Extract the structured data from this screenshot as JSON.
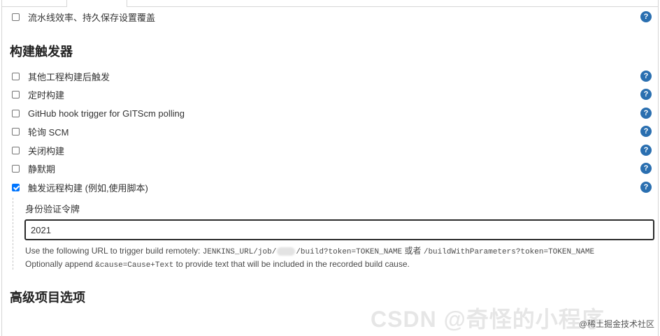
{
  "options_top": [
    {
      "label": "流水线效率、持久保存设置覆盖",
      "checked": false
    }
  ],
  "build_triggers": {
    "title": "构建触发器",
    "items": [
      {
        "label": "其他工程构建后触发",
        "checked": false
      },
      {
        "label": "定时构建",
        "checked": false
      },
      {
        "label": "GitHub hook trigger for GITScm polling",
        "checked": false
      },
      {
        "label": "轮询 SCM",
        "checked": false
      },
      {
        "label": "关闭构建",
        "checked": false
      },
      {
        "label": "静默期",
        "checked": false
      },
      {
        "label": "触发远程构建 (例如,使用脚本)",
        "checked": true
      }
    ],
    "remote": {
      "token_label": "身份验证令牌",
      "token_value": "2021",
      "url_prefix": "Use the following URL to trigger build remotely:",
      "url_code_1": "JENKINS_URL/job/",
      "url_code_2": "/build?token=TOKEN_NAME",
      "url_or": "或者",
      "url_code_3": "/buildWithParameters?token=TOKEN_NAME",
      "append_prefix": "Optionally append",
      "append_code": "&cause=Cause+Text",
      "append_suffix": "to provide text that will be included in the recorded build cause."
    }
  },
  "advanced": {
    "title": "高级项目选项"
  },
  "help_glyph": "?",
  "watermark": "CSDN @奇怪的小程序",
  "credit": "@稀土掘金技术社区",
  "colors": {
    "accent": "#0075ff",
    "help": "#2a6fb0"
  }
}
